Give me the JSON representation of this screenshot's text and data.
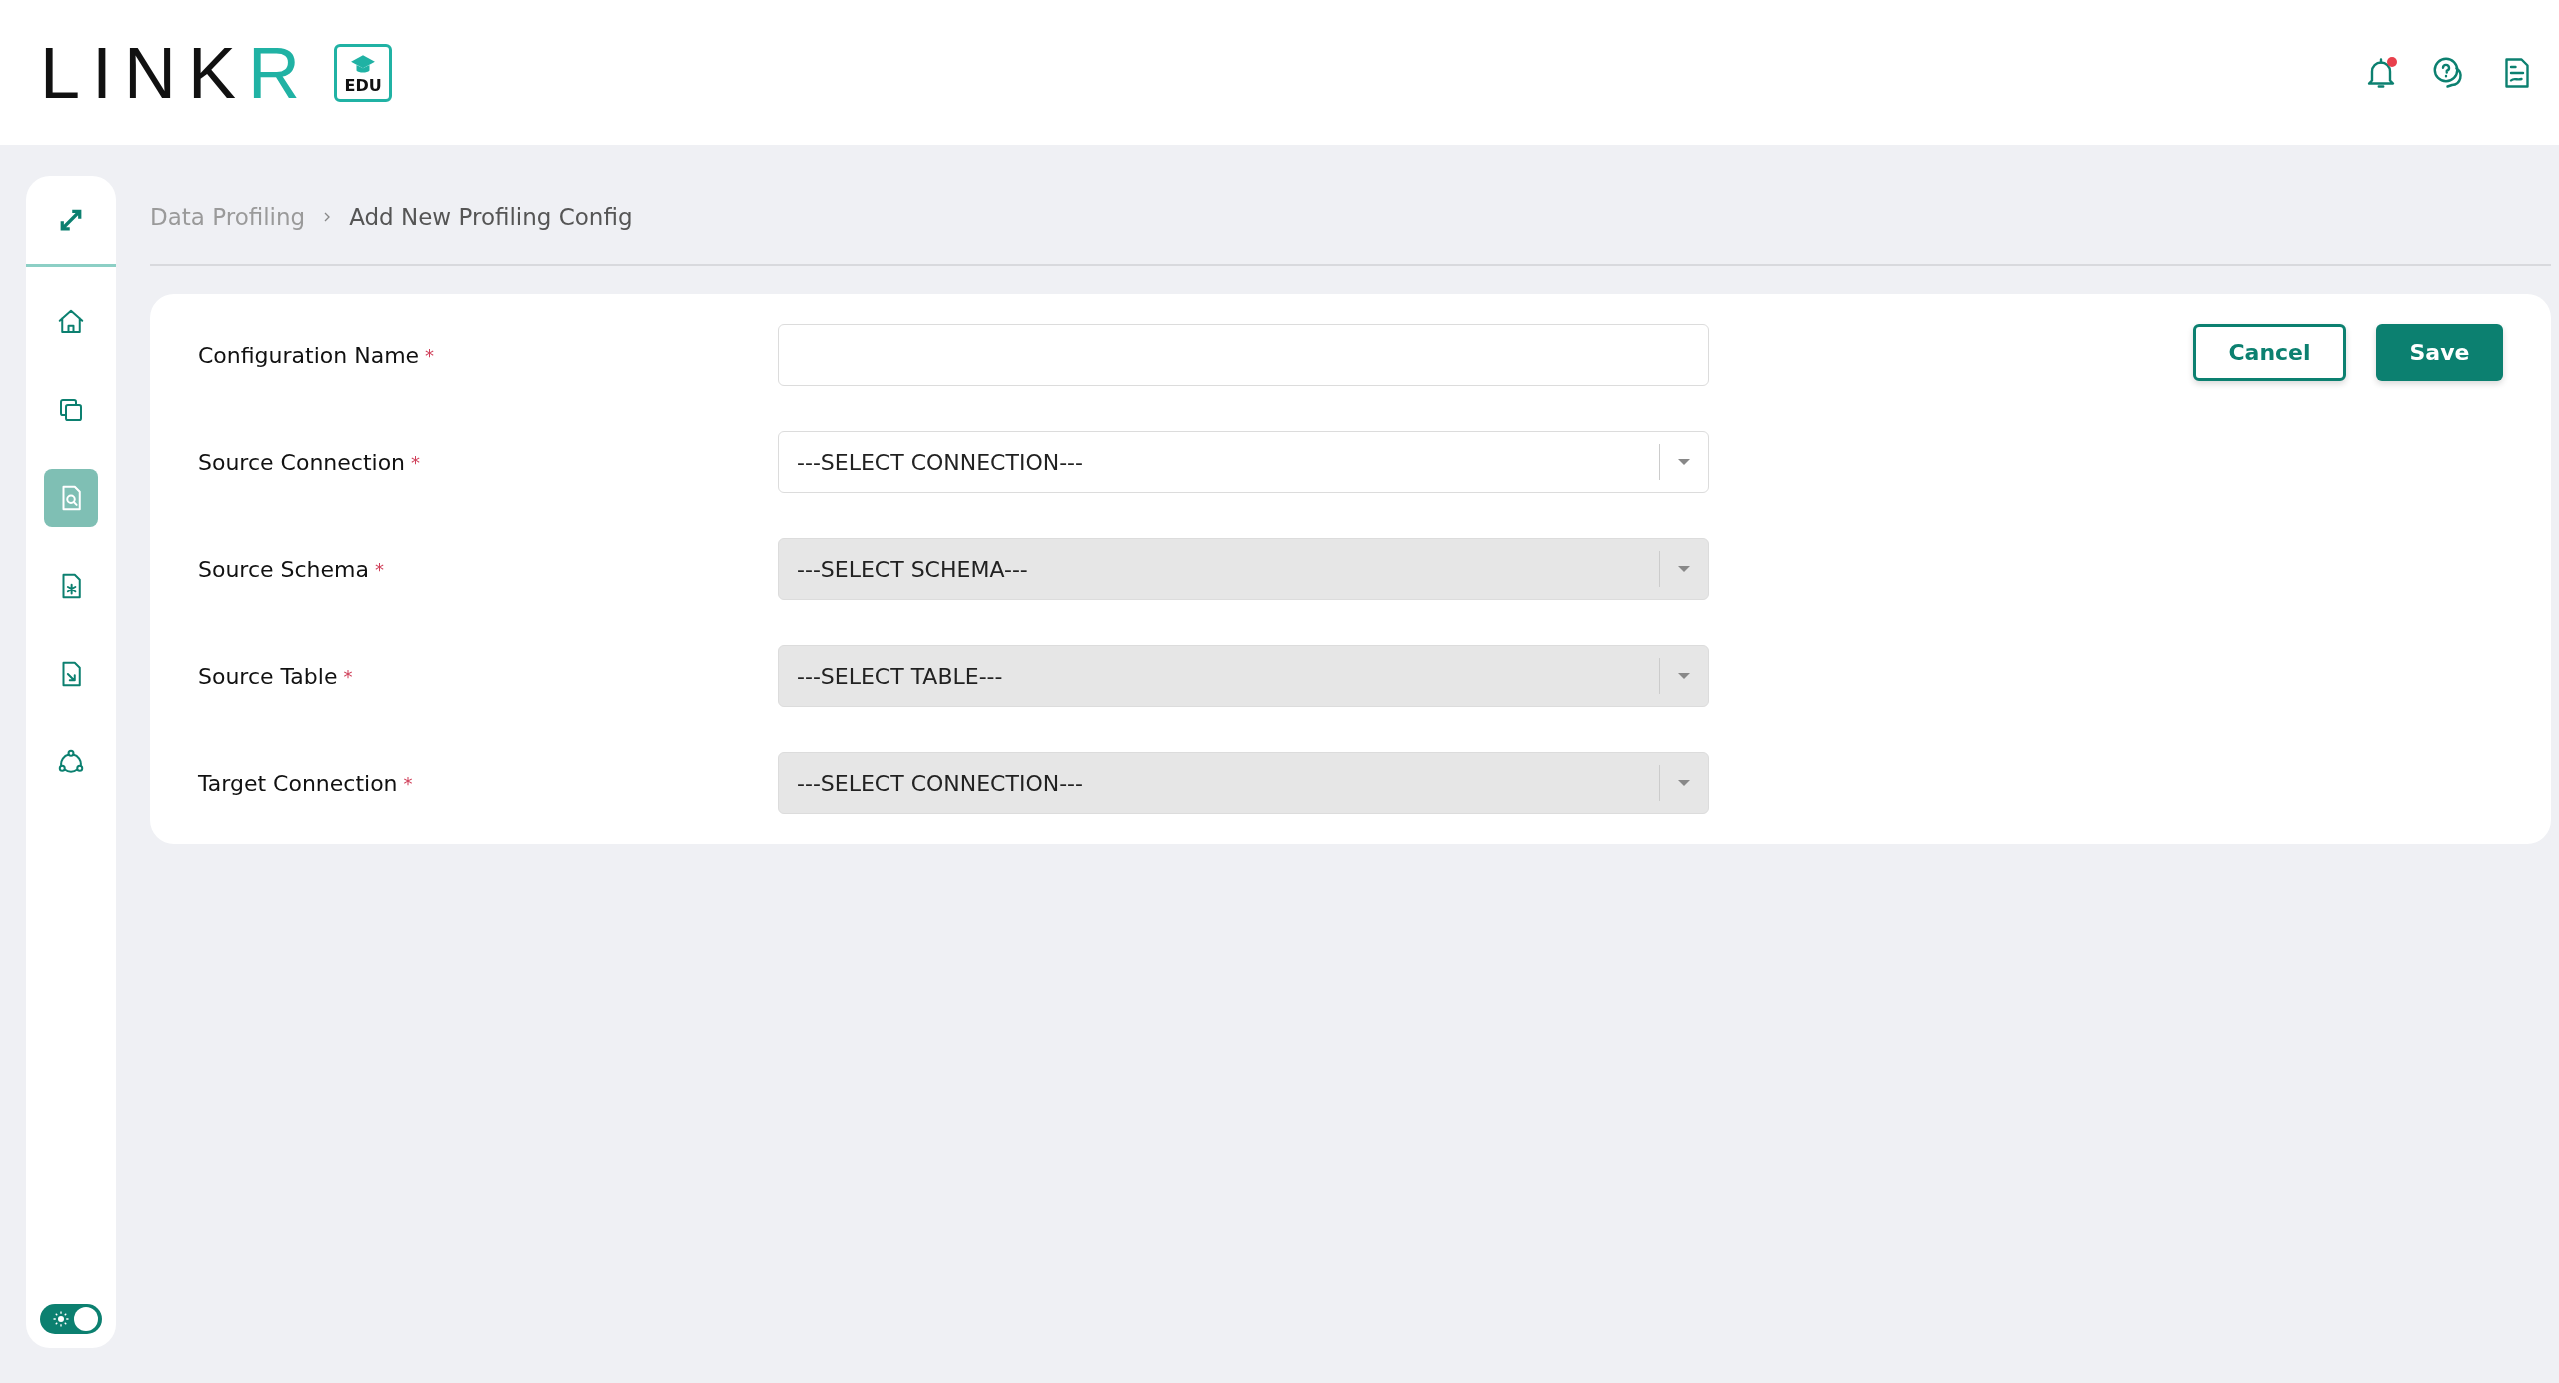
{
  "header": {
    "logo": {
      "text": "LINK",
      "accent": "R",
      "badge": "EDU"
    },
    "notifications": {
      "unread": true
    }
  },
  "sidebar": {
    "items": [
      {
        "selected": false
      },
      {
        "selected": false
      },
      {
        "selected": true
      },
      {
        "selected": false
      },
      {
        "selected": false
      },
      {
        "selected": false
      }
    ],
    "theme_toggle": {
      "on": true
    }
  },
  "breadcrumb": [
    "Data Profiling",
    "Add New Profiling Config"
  ],
  "form": {
    "fields": [
      {
        "kind": "text",
        "label": "Configuration Name",
        "required_mark": "*"
      },
      {
        "kind": "select",
        "label": "Source Connection",
        "required_mark": "*",
        "value": "---SELECT CONNECTION---",
        "disabled": false
      },
      {
        "kind": "select",
        "label": "Source Schema",
        "required_mark": "*",
        "value": "---SELECT SCHEMA---",
        "disabled": true
      },
      {
        "kind": "select",
        "label": "Source Table",
        "required_mark": "*",
        "value": "---SELECT TABLE---",
        "disabled": true
      },
      {
        "kind": "select",
        "label": "Target Connection",
        "required_mark": "*",
        "value": "---SELECT CONNECTION---",
        "disabled": true
      }
    ],
    "buttons": [
      {
        "kind": "secondary",
        "label": "Cancel"
      },
      {
        "kind": "primary",
        "label": "Save"
      }
    ]
  }
}
